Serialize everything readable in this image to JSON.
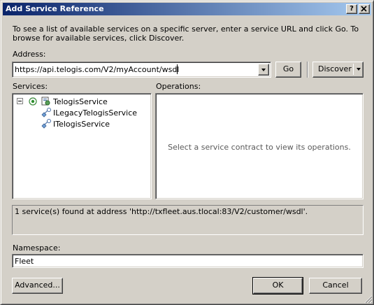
{
  "window": {
    "title": "Add Service Reference",
    "help_button": "?",
    "close_button": "X"
  },
  "instructions": "To see a list of available services on a specific server, enter a service URL and click Go. To browse for available services, click Discover.",
  "address": {
    "label": "Address:",
    "value": "https://api.telogis.com/V2/myAccount/wsdl",
    "go_label": "Go",
    "discover_label": "Discover"
  },
  "services": {
    "label": "Services:",
    "tree": {
      "expander": "⊟",
      "root": "TelogisService",
      "children": [
        "ILegacyTelogisService",
        "ITelogisService"
      ]
    }
  },
  "operations": {
    "label": "Operations:",
    "placeholder": "Select a service contract to view its operations."
  },
  "status_text": "1 service(s) found at address 'http://txfleet.aus.tlocal:83/V2/customer/wsdl'.",
  "namespace": {
    "label": "Namespace:",
    "value": "Fleet"
  },
  "footer": {
    "advanced_label": "Advanced...",
    "ok_label": "OK",
    "cancel_label": "Cancel"
  },
  "colors": {
    "dialog_face": "#d4d0c8",
    "titlebar_start": "#0a246a",
    "titlebar_end": "#a6caf0"
  }
}
